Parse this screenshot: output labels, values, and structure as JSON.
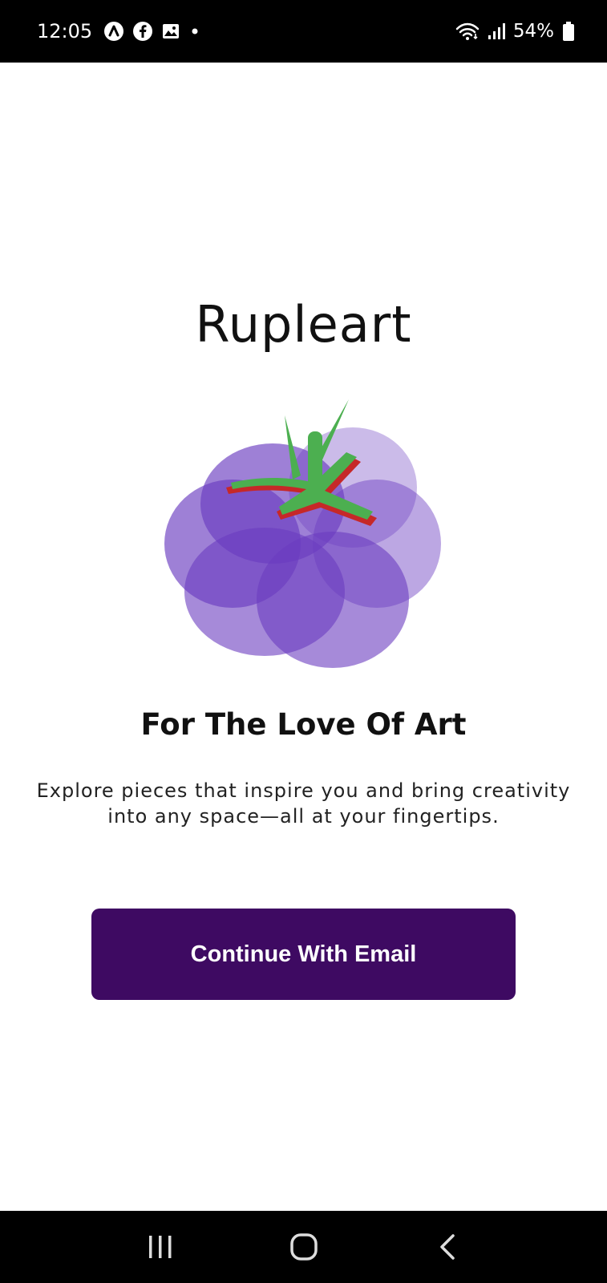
{
  "status_bar": {
    "time": "12:05",
    "notification_icons": [
      "arc-app-icon",
      "facebook-icon",
      "gallery-icon",
      "dot-icon"
    ],
    "system_icons": [
      "wifi-icon",
      "signal-icon",
      "battery-icon"
    ],
    "battery": "54%"
  },
  "app": {
    "title": "Rupleart",
    "tagline": "For The Love Of Art",
    "description": "Explore pieces that inspire you and bring creativity into any space—all at your fingertips.",
    "cta_label": "Continue With Email"
  },
  "nav_bar": {
    "buttons": [
      "recent-apps-icon",
      "home-icon",
      "back-icon"
    ]
  },
  "colors": {
    "cta_background": "#3e0a62",
    "logo_purple": "#6a3cc0",
    "logo_leaf": "#4caf50",
    "logo_leaf_edge": "#c62828"
  }
}
